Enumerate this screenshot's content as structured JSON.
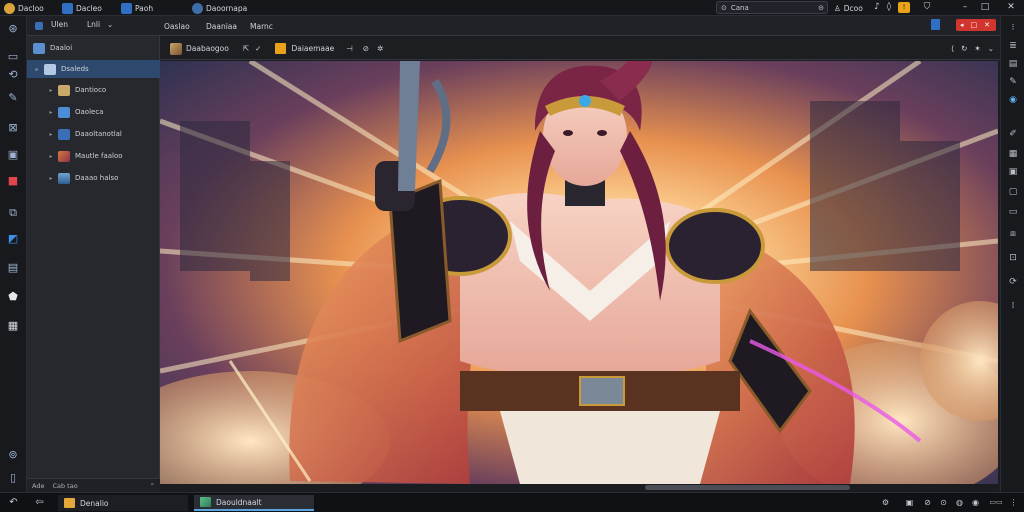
{
  "topbar": {
    "app_title": "Dacloo",
    "tab1": "Dacleo",
    "tab2": "Paoh",
    "tab3": "Daoornapa",
    "search_text": "Cana",
    "right_label": "Dcoo",
    "accent": "#e8a318"
  },
  "left_rail": {
    "icons": [
      "back-icon",
      "folder-icon",
      "sync-icon",
      "brush-icon",
      "close-box-icon",
      "terminal-icon",
      "gift-icon",
      "share-icon",
      "cube-icon",
      "window-icon",
      "shield-icon",
      "grid-icon",
      "help-icon",
      "document-icon",
      "settings-icon"
    ]
  },
  "panel": {
    "tab1": "Ulen",
    "tab2": "Lnli",
    "root_label": "Daaloi",
    "items": [
      {
        "label": "Dsaleds",
        "icon": "cube-icon",
        "color": "#5aa4e0"
      },
      {
        "label": "Dantioco",
        "icon": "folder-icon",
        "color": "#c9a86a"
      },
      {
        "label": "Oaoleca",
        "icon": "folder-icon",
        "color": "#4b8ed6"
      },
      {
        "label": "Daaoltanotlal",
        "icon": "book-icon",
        "color": "#3a6fb6"
      },
      {
        "label": "Mautle faaloo",
        "icon": "image-icon",
        "color": "#c0563a"
      },
      {
        "label": "Daaao halso",
        "icon": "landscape-icon",
        "color": "#4a86c0"
      }
    ],
    "footer": [
      "Ade",
      "Cab tao"
    ]
  },
  "viewer": {
    "tabs": [
      "Oaslao",
      "Daaniaa",
      "Marnc"
    ],
    "toolbar": {
      "image_button": "Daabaogoo",
      "layer_button": "Daiaemaae"
    }
  },
  "taskbar": {
    "task1": "Denalio",
    "task2": "Daouldnaalt"
  }
}
